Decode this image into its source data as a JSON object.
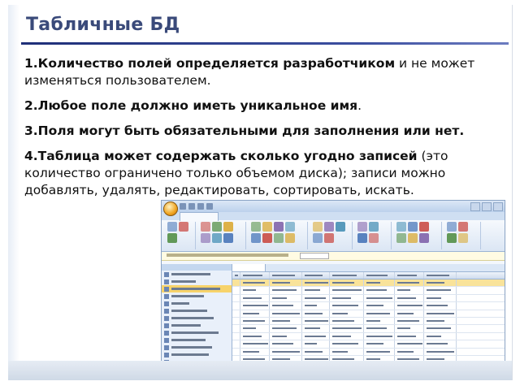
{
  "title": "Табличные БД",
  "points": [
    {
      "bold": "1.Количество полей определяется разработчиком",
      "normal": " и не может изменяться пользователем."
    },
    {
      "bold": "2.Любое поле должно иметь уникальное имя",
      "normal": "."
    },
    {
      "bold": "3.Поля могут быть обязательными для заполнения или нет.",
      "normal": ""
    },
    {
      "bold": "4.Таблица может содержать сколько угодно записей",
      "normal": " (это количество ограничено только объемом диска); записи можно добавлять, удалять, редактировать, сортировать, искать."
    }
  ],
  "colors": {
    "title": "#3a4a7a",
    "title_rule": "#1f2f78",
    "footer": "#cfd9e6",
    "access_ribbon": "#dbe6f4",
    "selection": "#f9e39a"
  },
  "icons": [
    "office-button-icon",
    "table-icon"
  ]
}
